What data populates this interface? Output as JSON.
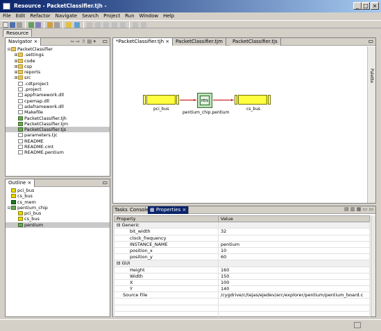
{
  "window": {
    "title": "Resource - PacketClassifier.tjh -"
  },
  "menu": [
    "File",
    "Edit",
    "Refactor",
    "Navigate",
    "Search",
    "Project",
    "Run",
    "Window",
    "Help"
  ],
  "perspective": {
    "label": "Resource"
  },
  "navigator": {
    "tab": "Navigator",
    "items": [
      {
        "label": "PacketClassifier",
        "kind": "folder",
        "level": 0,
        "twisty": "⊟"
      },
      {
        "label": ".settings",
        "kind": "folder",
        "level": 1,
        "twisty": "⊞"
      },
      {
        "label": "code",
        "kind": "folder",
        "level": 1,
        "twisty": "⊞"
      },
      {
        "label": "csp",
        "kind": "folder",
        "level": 1,
        "twisty": "⊞"
      },
      {
        "label": "reports",
        "kind": "folder",
        "level": 1,
        "twisty": "⊞"
      },
      {
        "label": "src",
        "kind": "folder",
        "level": 1,
        "twisty": "⊞"
      },
      {
        "label": ".cdtproject",
        "kind": "file",
        "level": 1,
        "twisty": ""
      },
      {
        "label": ".project",
        "kind": "file",
        "level": 1,
        "twisty": ""
      },
      {
        "label": "appframework.dll",
        "kind": "file",
        "level": 1,
        "twisty": ""
      },
      {
        "label": "cpemap.dll",
        "kind": "file",
        "level": 1,
        "twisty": ""
      },
      {
        "label": "adaframework.dll",
        "kind": "file",
        "level": 1,
        "twisty": ""
      },
      {
        "label": "Makefile",
        "kind": "file",
        "level": 1,
        "twisty": ""
      },
      {
        "label": "PacketClassifier.tjh",
        "kind": "chip",
        "level": 1,
        "twisty": ""
      },
      {
        "label": "PacketClassifier.tjm",
        "kind": "chip",
        "level": 1,
        "twisty": ""
      },
      {
        "label": "PacketClassifier.tjs",
        "kind": "chip",
        "level": 1,
        "twisty": "",
        "selected": true
      },
      {
        "label": "parameters.tjc",
        "kind": "file",
        "level": 1,
        "twisty": ""
      },
      {
        "label": "README",
        "kind": "file",
        "level": 1,
        "twisty": ""
      },
      {
        "label": "README.cmt",
        "kind": "file",
        "level": 1,
        "twisty": ""
      },
      {
        "label": "README.pentium",
        "kind": "file",
        "level": 1,
        "twisty": ""
      }
    ]
  },
  "outline": {
    "tab": "Outline",
    "items": [
      {
        "label": "pci_bus",
        "kind": "bus",
        "level": 0,
        "twisty": ""
      },
      {
        "label": "cs_bus",
        "kind": "bus",
        "level": 0,
        "twisty": ""
      },
      {
        "label": "cs_mem",
        "kind": "mem",
        "level": 0,
        "twisty": ""
      },
      {
        "label": "pentium_chip",
        "kind": "chip",
        "level": 0,
        "twisty": "⊟"
      },
      {
        "label": "pci_bus",
        "kind": "bus",
        "level": 1,
        "twisty": ""
      },
      {
        "label": "cs_bus",
        "kind": "bus",
        "level": 1,
        "twisty": ""
      },
      {
        "label": "pentium",
        "kind": "chip",
        "level": 1,
        "twisty": "",
        "selected": true
      }
    ]
  },
  "editor": {
    "tabs": [
      "*PacketClassifier.tjh",
      "PacketClassifier.tjm",
      "PacketClassifier.tjs"
    ],
    "palette_label": "Palette",
    "diagram": {
      "left_bus_label": "pci_bus",
      "chip_label": "pentium_chip.pentium",
      "chip_inner": "PEN",
      "right_bus_label": "cs_bus"
    }
  },
  "bottom": {
    "tabs": [
      "Tasks",
      "Console",
      "Properties"
    ],
    "columns": [
      "Property",
      "Value"
    ],
    "rows": [
      {
        "category": true,
        "name": "Generic",
        "value": ""
      },
      {
        "name": "bit_width",
        "value": "32"
      },
      {
        "name": "clock_frequency",
        "value": ""
      },
      {
        "name": "INSTANCE_NAME",
        "value": "pentium"
      },
      {
        "name": "position_x",
        "value": "10"
      },
      {
        "name": "position_y",
        "value": "60"
      },
      {
        "category": true,
        "name": "GUI",
        "value": ""
      },
      {
        "name": "Height",
        "value": "160"
      },
      {
        "name": "Width",
        "value": "150"
      },
      {
        "name": "X",
        "value": "100"
      },
      {
        "name": "Y",
        "value": "140"
      },
      {
        "name": "Source File",
        "value": "/cygdrive/c/tejas/ejedev/arc/explorer/pentium/pentium_board.c",
        "top": true
      }
    ]
  },
  "colors": {
    "titlebar": "#0a246a",
    "bus": "#ffff40",
    "chip": "#b8e0b8",
    "wire": "#c00000"
  }
}
